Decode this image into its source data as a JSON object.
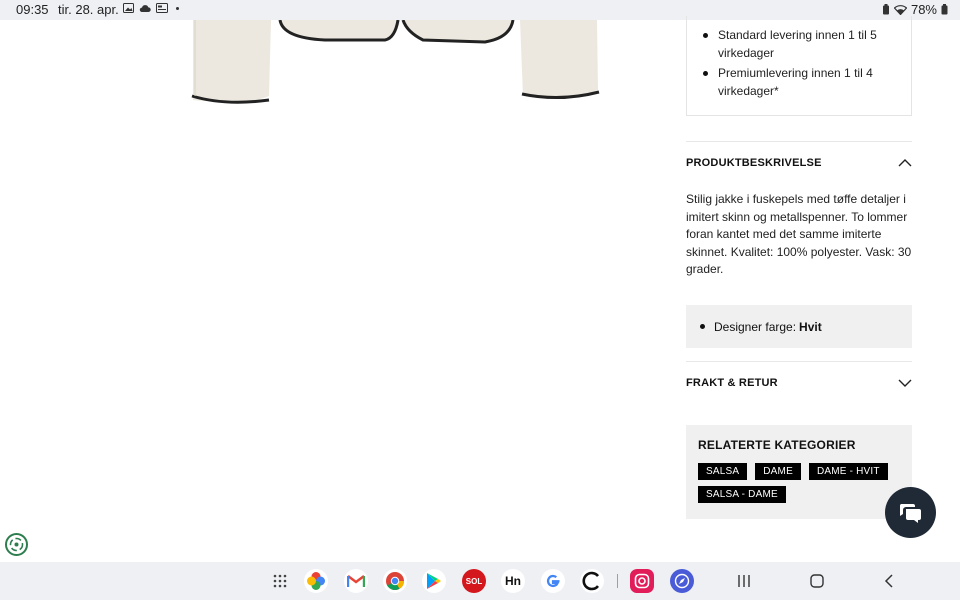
{
  "status": {
    "time": "09:35",
    "date": "tir. 28. apr.",
    "battery": "78%"
  },
  "delivery": {
    "items": [
      "Standard levering innen 1 til 5 virkedager",
      "Premiumlevering innen 1 til 4 virkedager*"
    ]
  },
  "description": {
    "title": "PRODUKTBESKRIVELSE",
    "text": "Stilig jakke i fuskepels med tøffe detaljer i imitert skinn og metallspenner. To lommer foran kantet med det samme imiterte skinnet. Kvalitet: 100% polyester. Vask: 30 grader."
  },
  "designer": {
    "label": "Designer farge:",
    "value": "Hvit"
  },
  "shipping": {
    "title": "FRAKT & RETUR"
  },
  "related": {
    "title": "RELATERTE KATEGORIER",
    "tags": [
      "SALSA",
      "DAME",
      "DAME - HVIT",
      "SALSA - DAME"
    ]
  },
  "dock": {
    "apps": [
      "app-drawer",
      "photos",
      "gmail",
      "chrome",
      "play-store",
      "sol",
      "hn",
      "google",
      "c-app",
      "instagram",
      "compass-app"
    ]
  },
  "colors": {
    "chat_button": "#1f2a36",
    "panel_bg": "#f0f0f0",
    "tag_bg": "#000000",
    "system_bar": "#eef0f4"
  }
}
